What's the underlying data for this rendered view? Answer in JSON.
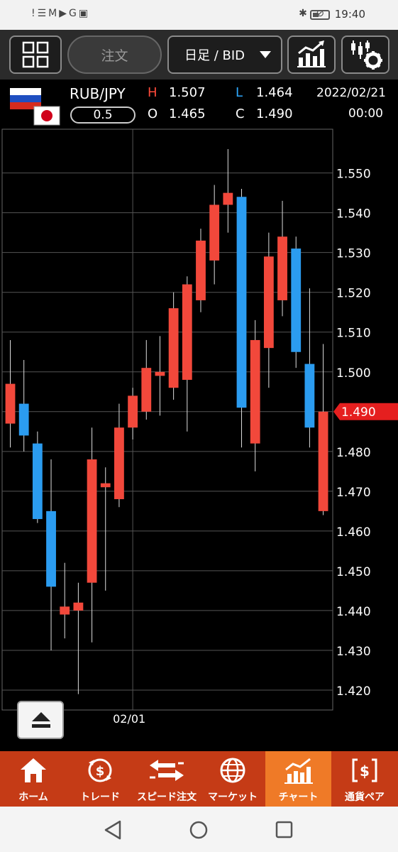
{
  "status_bar": {
    "left_icons": "!☰M▶G▣",
    "time": "19:40"
  },
  "toolbar": {
    "order_label": "注文",
    "period_label": "日足 / BID"
  },
  "info": {
    "pair": "RUB/JPY",
    "lot": "0.5",
    "h_label": "H",
    "h_value": "1.507",
    "l_label": "L",
    "l_value": "1.464",
    "o_label": "O",
    "o_value": "1.465",
    "c_label": "C",
    "c_value": "1.490",
    "date": "2022/02/21",
    "time": "00:00",
    "colors": {
      "h": "#ff4a3a",
      "l": "#2ea8ff",
      "white": "#ffffff"
    }
  },
  "chart_data": {
    "type": "candlestick",
    "ylim": [
      1.415,
      1.561
    ],
    "y_ticks": [
      "1.550",
      "1.540",
      "1.530",
      "1.520",
      "1.510",
      "1.500",
      "1.490",
      "1.480",
      "1.470",
      "1.460",
      "1.450",
      "1.440",
      "1.430",
      "1.420"
    ],
    "x_label": "02/01",
    "current_price": "1.490",
    "colors": {
      "up": "#f2483b",
      "down": "#2b9cf0",
      "price_tag": "#e51f1f"
    },
    "candles": [
      {
        "o": 1.487,
        "h": 1.508,
        "l": 1.481,
        "c": 1.497
      },
      {
        "o": 1.492,
        "h": 1.503,
        "l": 1.48,
        "c": 1.484
      },
      {
        "o": 1.482,
        "h": 1.485,
        "l": 1.462,
        "c": 1.463
      },
      {
        "o": 1.465,
        "h": 1.478,
        "l": 1.43,
        "c": 1.446
      },
      {
        "o": 1.439,
        "h": 1.452,
        "l": 1.433,
        "c": 1.441
      },
      {
        "o": 1.44,
        "h": 1.447,
        "l": 1.419,
        "c": 1.442
      },
      {
        "o": 1.447,
        "h": 1.486,
        "l": 1.432,
        "c": 1.478
      },
      {
        "o": 1.471,
        "h": 1.476,
        "l": 1.445,
        "c": 1.472
      },
      {
        "o": 1.468,
        "h": 1.492,
        "l": 1.466,
        "c": 1.486
      },
      {
        "o": 1.486,
        "h": 1.496,
        "l": 1.483,
        "c": 1.494
      },
      {
        "o": 1.49,
        "h": 1.508,
        "l": 1.488,
        "c": 1.501
      },
      {
        "o": 1.499,
        "h": 1.509,
        "l": 1.489,
        "c": 1.5
      },
      {
        "o": 1.496,
        "h": 1.52,
        "l": 1.493,
        "c": 1.516
      },
      {
        "o": 1.498,
        "h": 1.524,
        "l": 1.485,
        "c": 1.522
      },
      {
        "o": 1.518,
        "h": 1.536,
        "l": 1.515,
        "c": 1.533
      },
      {
        "o": 1.528,
        "h": 1.547,
        "l": 1.522,
        "c": 1.542
      },
      {
        "o": 1.542,
        "h": 1.556,
        "l": 1.535,
        "c": 1.545
      },
      {
        "o": 1.544,
        "h": 1.546,
        "l": 1.481,
        "c": 1.491
      },
      {
        "o": 1.482,
        "h": 1.513,
        "l": 1.475,
        "c": 1.508
      },
      {
        "o": 1.506,
        "h": 1.535,
        "l": 1.496,
        "c": 1.529
      },
      {
        "o": 1.518,
        "h": 1.543,
        "l": 1.514,
        "c": 1.534
      },
      {
        "o": 1.531,
        "h": 1.534,
        "l": 1.501,
        "c": 1.505
      },
      {
        "o": 1.502,
        "h": 1.521,
        "l": 1.481,
        "c": 1.486
      },
      {
        "o": 1.465,
        "h": 1.507,
        "l": 1.464,
        "c": 1.49
      }
    ]
  },
  "bottom_nav": {
    "items": [
      {
        "label": "ホーム",
        "icon": "home-icon"
      },
      {
        "label": "トレード",
        "icon": "trade-icon"
      },
      {
        "label": "スピード注文",
        "icon": "speed-order-icon"
      },
      {
        "label": "マーケット",
        "icon": "market-icon"
      },
      {
        "label": "チャート",
        "icon": "chart-icon"
      },
      {
        "label": "通貨ペア",
        "icon": "currency-pair-icon"
      }
    ],
    "active_color": "#ef7a27"
  }
}
